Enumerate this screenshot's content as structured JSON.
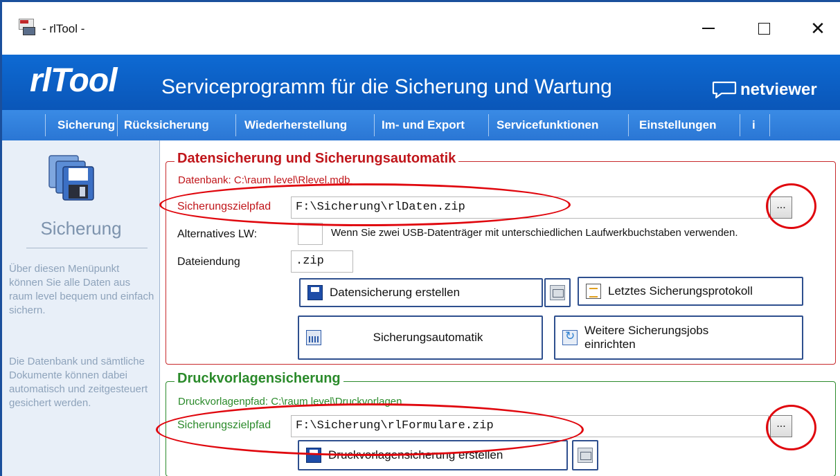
{
  "window": {
    "title": "- rlTool -",
    "app_icon": "rltool-app-icon"
  },
  "banner": {
    "brand": "rlTool",
    "tagline": "Serviceprogramm für die Sicherung und Wartung",
    "partner": "netviewer",
    "partner_icon": "chat-bubble-icon"
  },
  "menu": [
    "Sicherung",
    "Rücksicherung",
    "Wiederherstellung",
    "Im- und Export",
    "Servicefunktionen",
    "Einstellungen",
    "i"
  ],
  "sidebar": {
    "icon": "floppy-disks-icon",
    "title": "Sicherung",
    "paragraph1": "Über diesen Menüpunkt können Sie alle Daten aus raum level bequem und einfach sichern.",
    "paragraph2": "Die Datenbank und sämtliche Dokumente können dabei automatisch und zeitgesteuert gesichert werden."
  },
  "backup": {
    "title": "Datensicherung und Sicherungsautomatik",
    "database_path": "Datenbank: C:\\raum level\\Rlevel.mdb",
    "target_label": "Sicherungszielpfad",
    "target_value": "F:\\Sicherung\\rlDaten.zip",
    "browse_label": "...",
    "alt_drive_label": "Alternatives LW:",
    "alt_drive_value": "",
    "alt_drive_hint": "Wenn Sie zwei USB-Datenträger mit unterschiedlichen Laufwerkbuchstaben verwenden.",
    "extension_label": "Dateiendung",
    "extension_value": ".zip",
    "create_button": "Datensicherung erstellen",
    "last_log_button": "Letztes Sicherungsprotokoll",
    "automation_button": "Sicherungsautomatik",
    "more_jobs_button": "Weitere Sicherungsjobs einrichten"
  },
  "templates": {
    "title": "Druckvorlagensicherung",
    "templates_path": "Druckvorlagenpfad: C:\\raum level\\Druckvorlagen",
    "target_label": "Sicherungszielpfad",
    "target_value": "F:\\Sicherung\\rlFormulare.zip",
    "browse_label": "...",
    "create_button": "Druckvorlagensicherung erstellen"
  },
  "colors": {
    "banner": "#0a5fc4",
    "menubar": "#2f80dc",
    "backup_accent": "#c0151a",
    "templates_accent": "#2a8a2a",
    "annotation": "#e0060d"
  }
}
